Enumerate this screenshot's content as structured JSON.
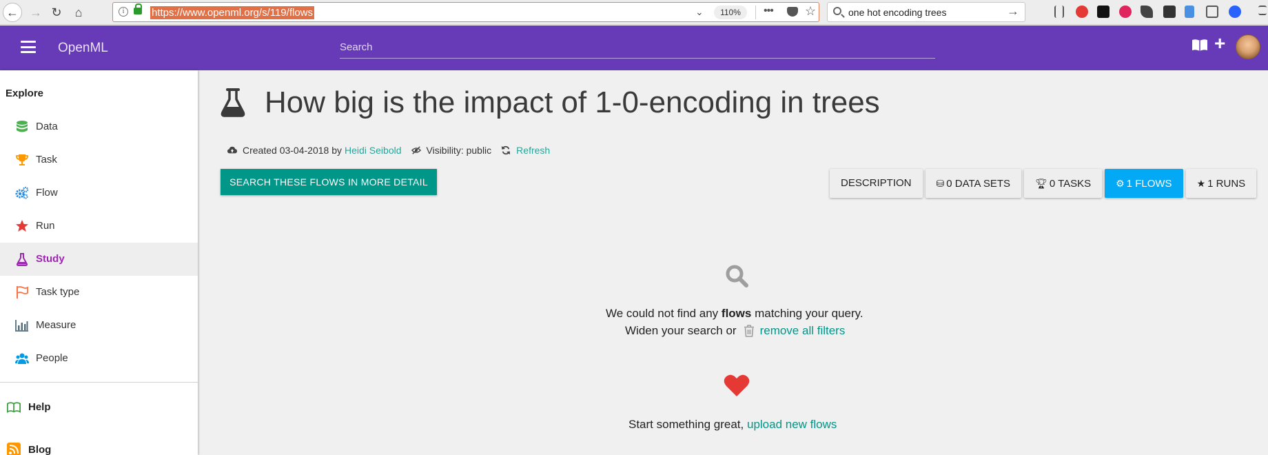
{
  "browser": {
    "url": "https://www.openml.org/s/119/flows",
    "zoom": "110%",
    "search_query": "one hot encoding trees"
  },
  "header": {
    "brand": "OpenML",
    "search_placeholder": "Search",
    "accent": "#673ab7"
  },
  "sidebar": {
    "section_title": "Explore",
    "items": [
      {
        "label": "Data",
        "icon": "database-icon",
        "color": "#4caf50"
      },
      {
        "label": "Task",
        "icon": "trophy-icon",
        "color": "#ff9800"
      },
      {
        "label": "Flow",
        "icon": "cogs-icon",
        "color": "#2196f3"
      },
      {
        "label": "Run",
        "icon": "star-icon",
        "color": "#f44336"
      },
      {
        "label": "Study",
        "icon": "flask-icon",
        "color": "#9c27b0",
        "active": true
      },
      {
        "label": "Task type",
        "icon": "flag-icon",
        "color": "#ff7043"
      },
      {
        "label": "Measure",
        "icon": "bar-chart-icon",
        "color": "#607d8b"
      },
      {
        "label": "People",
        "icon": "users-icon",
        "color": "#03a9f4"
      }
    ],
    "help_label": "Help",
    "blog_label": "Blog"
  },
  "main": {
    "title": "How big is the impact of 1-0-encoding in trees",
    "created_text": "Created 03-04-2018 by",
    "author": "Heidi Seibold",
    "visibility": "Visibility: public",
    "refresh": "Refresh",
    "search_button": "SEARCH THESE FLOWS IN MORE DETAIL",
    "tabs": [
      {
        "label": "DESCRIPTION",
        "icon": ""
      },
      {
        "label": "0 DATA SETS",
        "icon": "database-icon"
      },
      {
        "label": "0 TASKS",
        "icon": "trophy-icon"
      },
      {
        "label": "1 FLOWS",
        "icon": "cogs-icon",
        "active": true
      },
      {
        "label": "1 RUNS",
        "icon": "star-icon"
      }
    ],
    "empty": {
      "line1_prefix": "We could not find any ",
      "line1_bold": "flows",
      "line1_suffix": " matching your query.",
      "line2_prefix": "Widen your search or",
      "remove_filters": "remove all filters",
      "cta_prefix": "Start something great, ",
      "cta_link": "upload new flows"
    }
  }
}
